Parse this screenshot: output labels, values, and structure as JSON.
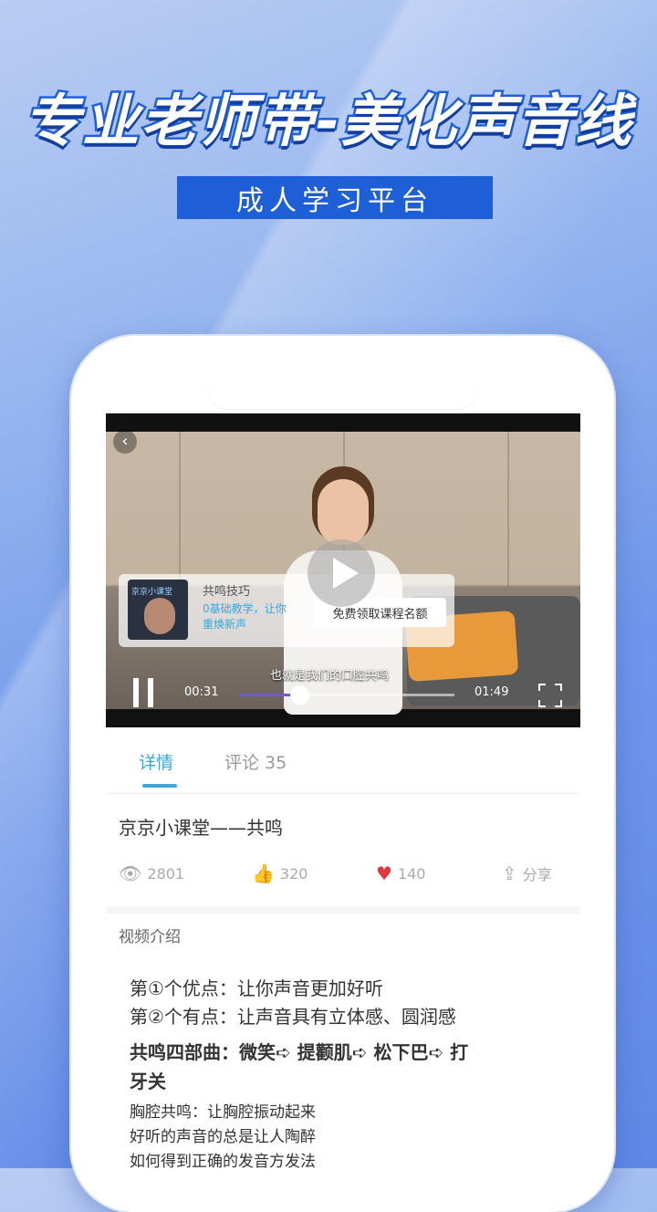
{
  "banner": {
    "headline": "专业老师带-美化声音线",
    "subtitle": "成人学习平台"
  },
  "video": {
    "promo": {
      "thumb_text": "京京小课堂",
      "title": "共鸣技巧",
      "desc": "0基础教学，让你重焕新声",
      "button": "免费领取课程名额"
    },
    "caption": "也就是我们的口腔共鸣",
    "time_current": "00:31",
    "time_total": "01:49",
    "progress": 0.28
  },
  "tabs": {
    "detail": "详情",
    "comments": "评论 35"
  },
  "title": "京京小课堂——共鸣",
  "stats": {
    "views": "2801",
    "likes": "320",
    "favorites": "140",
    "share": "分享"
  },
  "intro": {
    "label": "视频介绍",
    "line1": "第①个优点：让你声音更加好听",
    "line2": "第②个有点：让声音具有立体感、圆润感",
    "line3": "共鸣四部曲：微笑➪ 提颧肌➪ 松下巴➪ 打",
    "line4": "牙关",
    "line5": "胸腔共鸣：让胸腔振动起来",
    "line6": "好听的声音的总是让人陶醉",
    "line7": "如何得到正确的发音方发法"
  },
  "colors": {
    "accent": "#3fa6d8",
    "banner_blue": "#1e5ed6",
    "like_red": "#e0383b"
  },
  "icons": [
    "back-icon",
    "play-icon",
    "pause-icon",
    "fullscreen-icon",
    "eye-icon",
    "thumbs-up-icon",
    "heart-icon",
    "share-icon"
  ]
}
